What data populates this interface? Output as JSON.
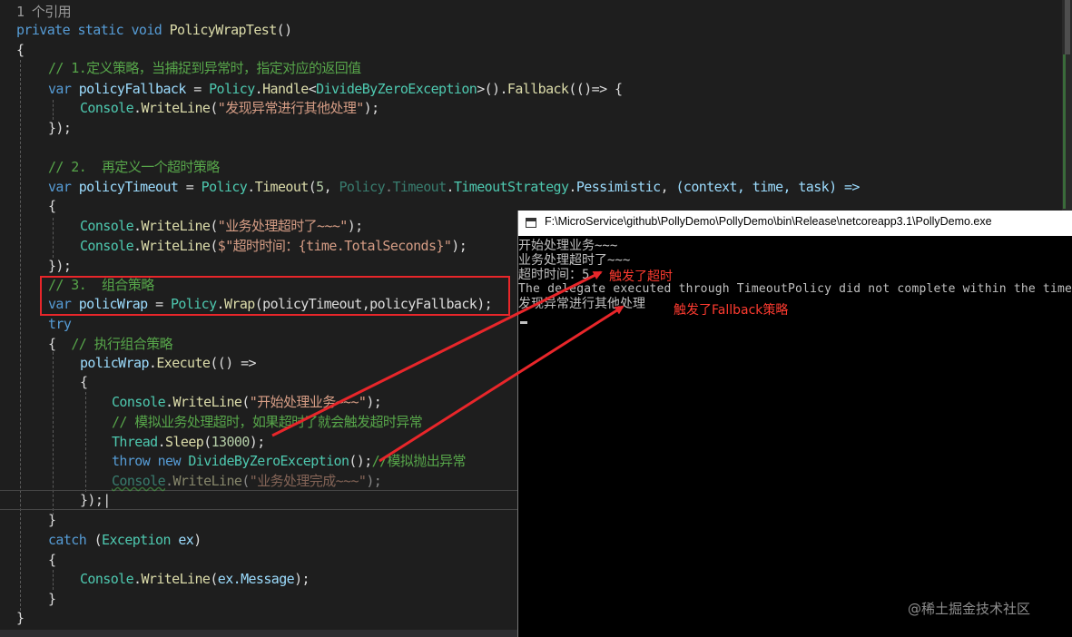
{
  "editor": {
    "references": "1 个引用",
    "method_keywords": "private static void",
    "method_name": "PolicyWrapTest",
    "method_parens": "()",
    "open_brace": "{",
    "close_brace": "}",
    "comment1": "// 1.定义策略，当捕捉到异常时，指定对应的返回值",
    "kw_var": "var",
    "fallback_var": "policyFallback",
    "eq": "=",
    "policy": "Policy",
    "handle": "Handle",
    "divide_exc": "DivideByZeroException",
    "fallback": "Fallback",
    "console": "Console",
    "writeline": "WriteLine",
    "str_fallback": "\"发现异常进行其他处理\"",
    "close_lambda": "});",
    "comment2": "// 2.  再定义一个超时策略",
    "timeout_var": "policyTimeout",
    "timeout": "Timeout",
    "num5": "5",
    "timeout_strategy": "TimeoutStrategy",
    "pessimistic": "Pessimistic",
    "ctx_args": "(context, time, task) =>",
    "str_timeout": "\"业务处理超时了~~~\"",
    "str_interp": "$\"超时时间：{time.TotalSeconds}\"",
    "comment3": "// 3.  组合策略",
    "wrap_var": "policWrap",
    "wrap": "Wrap",
    "wrap_args": "(policyTimeout,policyFallback);",
    "kw_try": "try",
    "comment4": "// 执行组合策略",
    "execute": "Execute",
    "str_start": "\"开始处理业务~~~\"",
    "comment5": "// 模拟业务处理超时，如果超时了就会触发超时异常",
    "thread": "Thread",
    "sleep": "Sleep",
    "num13000": "13000",
    "kw_throw": "throw",
    "kw_new": "new",
    "comment6": "//模拟抛出异常",
    "str_done": "\"业务处理完成~~~\"",
    "close_exec": "});",
    "kw_catch": "catch",
    "exception_type": "Exception",
    "ex": "ex",
    "ex_message": "ex.Message"
  },
  "console_window": {
    "title": "F:\\MicroService\\github\\PollyDemo\\PollyDemo\\bin\\Release\\netcoreapp3.1\\PollyDemo.exe",
    "lines": [
      "开始处理业务~~~",
      "业务处理超时了~~~",
      "超时时间：5",
      "The delegate executed through TimeoutPolicy did not complete within the timeout.",
      "发现异常进行其他处理"
    ]
  },
  "annotations": {
    "timeout_triggered": "触发了超时",
    "fallback_triggered": "触发了Fallback策略"
  },
  "watermark": "@稀土掘金技术社区",
  "colors": {
    "editor_bg": "#1e1e1e",
    "console_bg": "#000000",
    "annotation": "#ff3b30",
    "highlight_box": "#e8262a"
  }
}
